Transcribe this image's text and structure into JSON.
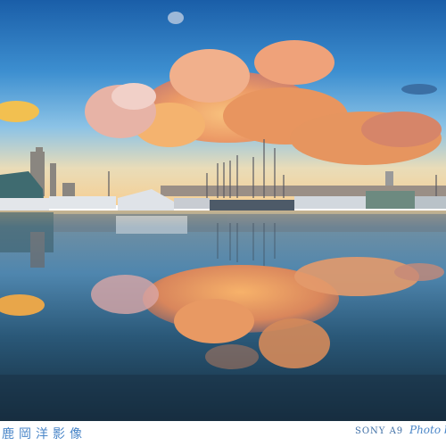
{
  "photo": {
    "scene": "harbor-sunset-reflection"
  },
  "caption": {
    "author": "鹿岡洋影像",
    "camera": "SONY A9",
    "credit": "Photo b"
  },
  "colors": {
    "sky_top": "#1f63ad",
    "sky_horizon": "#f3d79c",
    "cloud": "#f0a06a",
    "water_dark": "#1d3a50",
    "caption_text": "#4a86c8"
  }
}
